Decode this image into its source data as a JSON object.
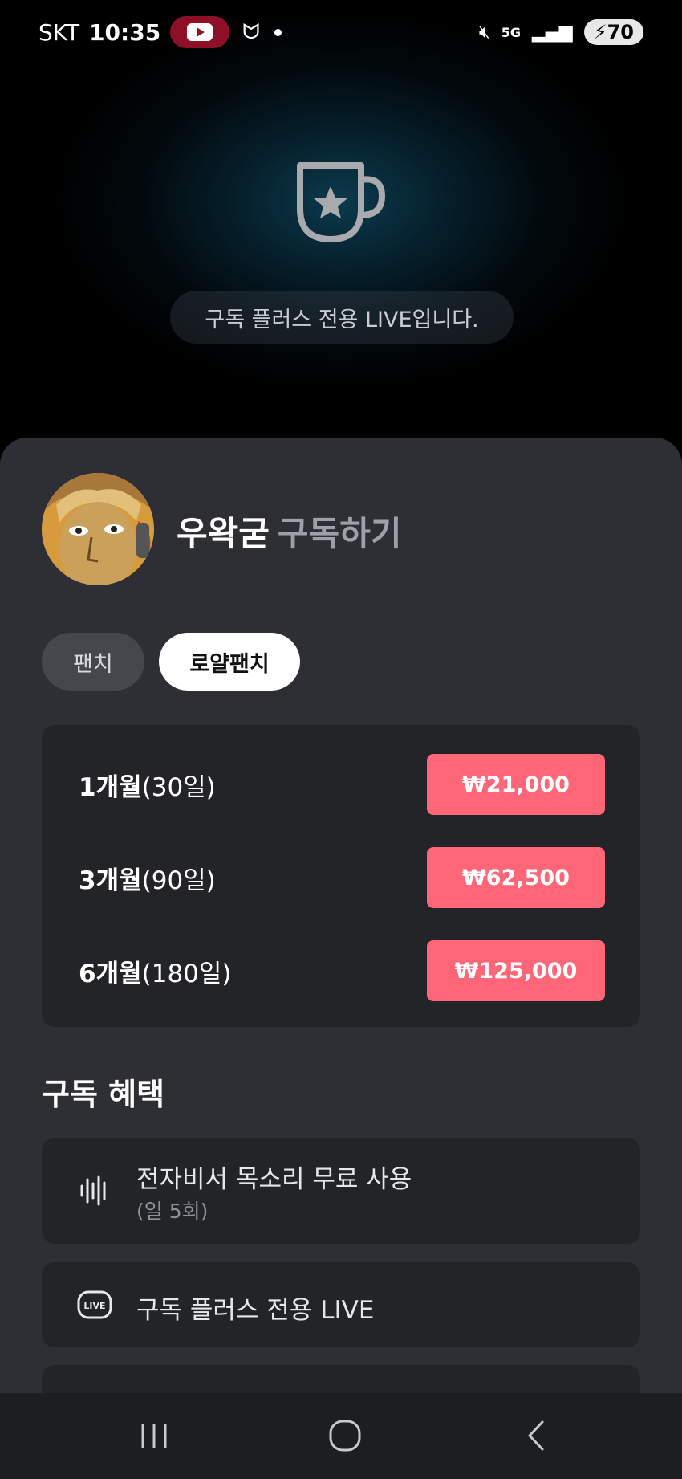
{
  "status_bar": {
    "carrier": "SKT",
    "time": "10:35",
    "battery": "70",
    "network": "5G"
  },
  "video": {
    "notice": "구독 플러스 전용 LIVE입니다.",
    "icon": "cup-star-icon"
  },
  "subscribe": {
    "streamer_name": "우왁굳",
    "action": "구독하기",
    "tabs": [
      {
        "label": "팬치",
        "selected": false
      },
      {
        "label": "로얄팬치",
        "selected": true
      }
    ],
    "plans": [
      {
        "months": "1개월",
        "days": "(30일)",
        "price": "₩21,000"
      },
      {
        "months": "3개월",
        "days": "(90일)",
        "price": "₩62,500"
      },
      {
        "months": "6개월",
        "days": "(180일)",
        "price": "₩125,000"
      }
    ]
  },
  "benefits": {
    "title": "구독 혜택",
    "items": [
      {
        "label": "전자비서 목소리 무료 사용",
        "sub": "(일 5회)",
        "icon": "voice-waveform-icon"
      },
      {
        "label": "구독 플러스 전용 LIVE",
        "icon": "live-badge-icon"
      }
    ]
  },
  "colors": {
    "accent": "#ff6677",
    "sheet_bg": "#2e2f34",
    "card_bg": "#232428"
  }
}
